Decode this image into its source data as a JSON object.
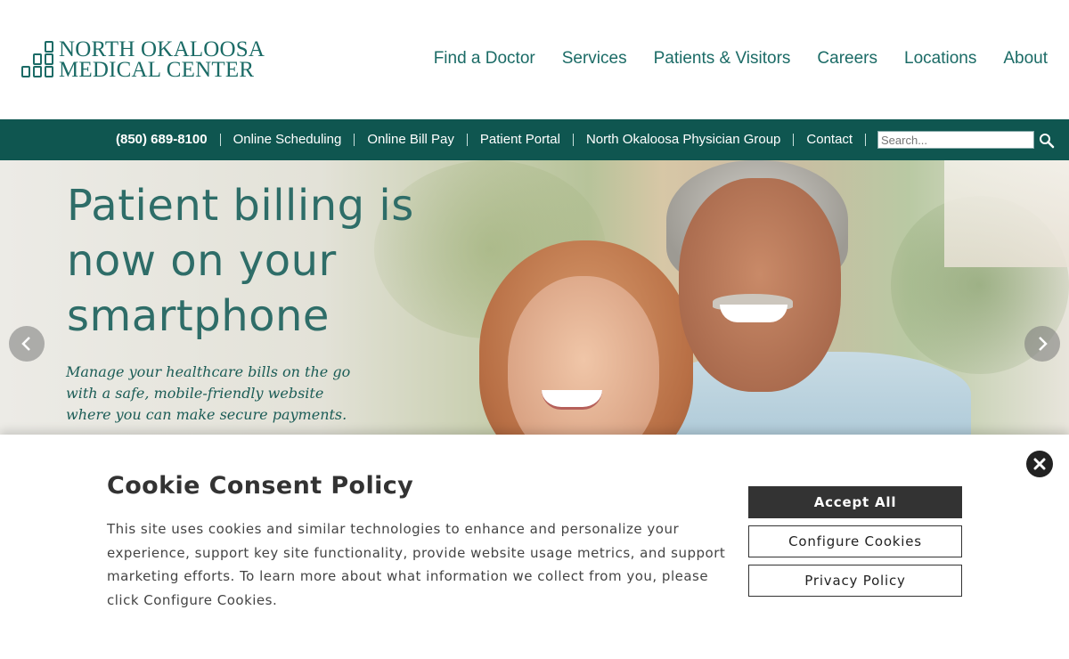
{
  "brand": {
    "logo_line1": "NORTH OKALOOSA",
    "logo_line2": "MEDICAL CENTER",
    "color_primary": "#1b6b66",
    "color_bar": "#0f5650"
  },
  "main_nav": [
    {
      "label": "Find a Doctor"
    },
    {
      "label": "Services"
    },
    {
      "label": "Patients & Visitors"
    },
    {
      "label": "Careers"
    },
    {
      "label": "Locations"
    },
    {
      "label": "About"
    }
  ],
  "utility_bar": {
    "phone": "(850) 689-8100",
    "links": [
      {
        "label": "Online Scheduling"
      },
      {
        "label": "Online Bill Pay"
      },
      {
        "label": "Patient Portal"
      },
      {
        "label": "North Okaloosa Physician Group"
      },
      {
        "label": "Contact"
      }
    ],
    "search_placeholder": "Search..."
  },
  "hero": {
    "headline": "Patient billing is now on your smartphone",
    "subtext": "Manage your healthcare bills on the go with a safe, mobile-friendly website where you can make secure payments.",
    "prev_icon": "chevron-left-icon",
    "next_icon": "chevron-right-icon"
  },
  "cookie": {
    "title": "Cookie Consent Policy",
    "body": "This site uses cookies and similar technologies to enhance and personalize your experience, support key site functionality, provide website usage metrics, and support marketing efforts. To learn more about what information we collect from you, please click Configure Cookies.",
    "accept_label": "Accept All",
    "configure_label": "Configure Cookies",
    "privacy_label": "Privacy Policy",
    "close_icon": "close-icon"
  }
}
